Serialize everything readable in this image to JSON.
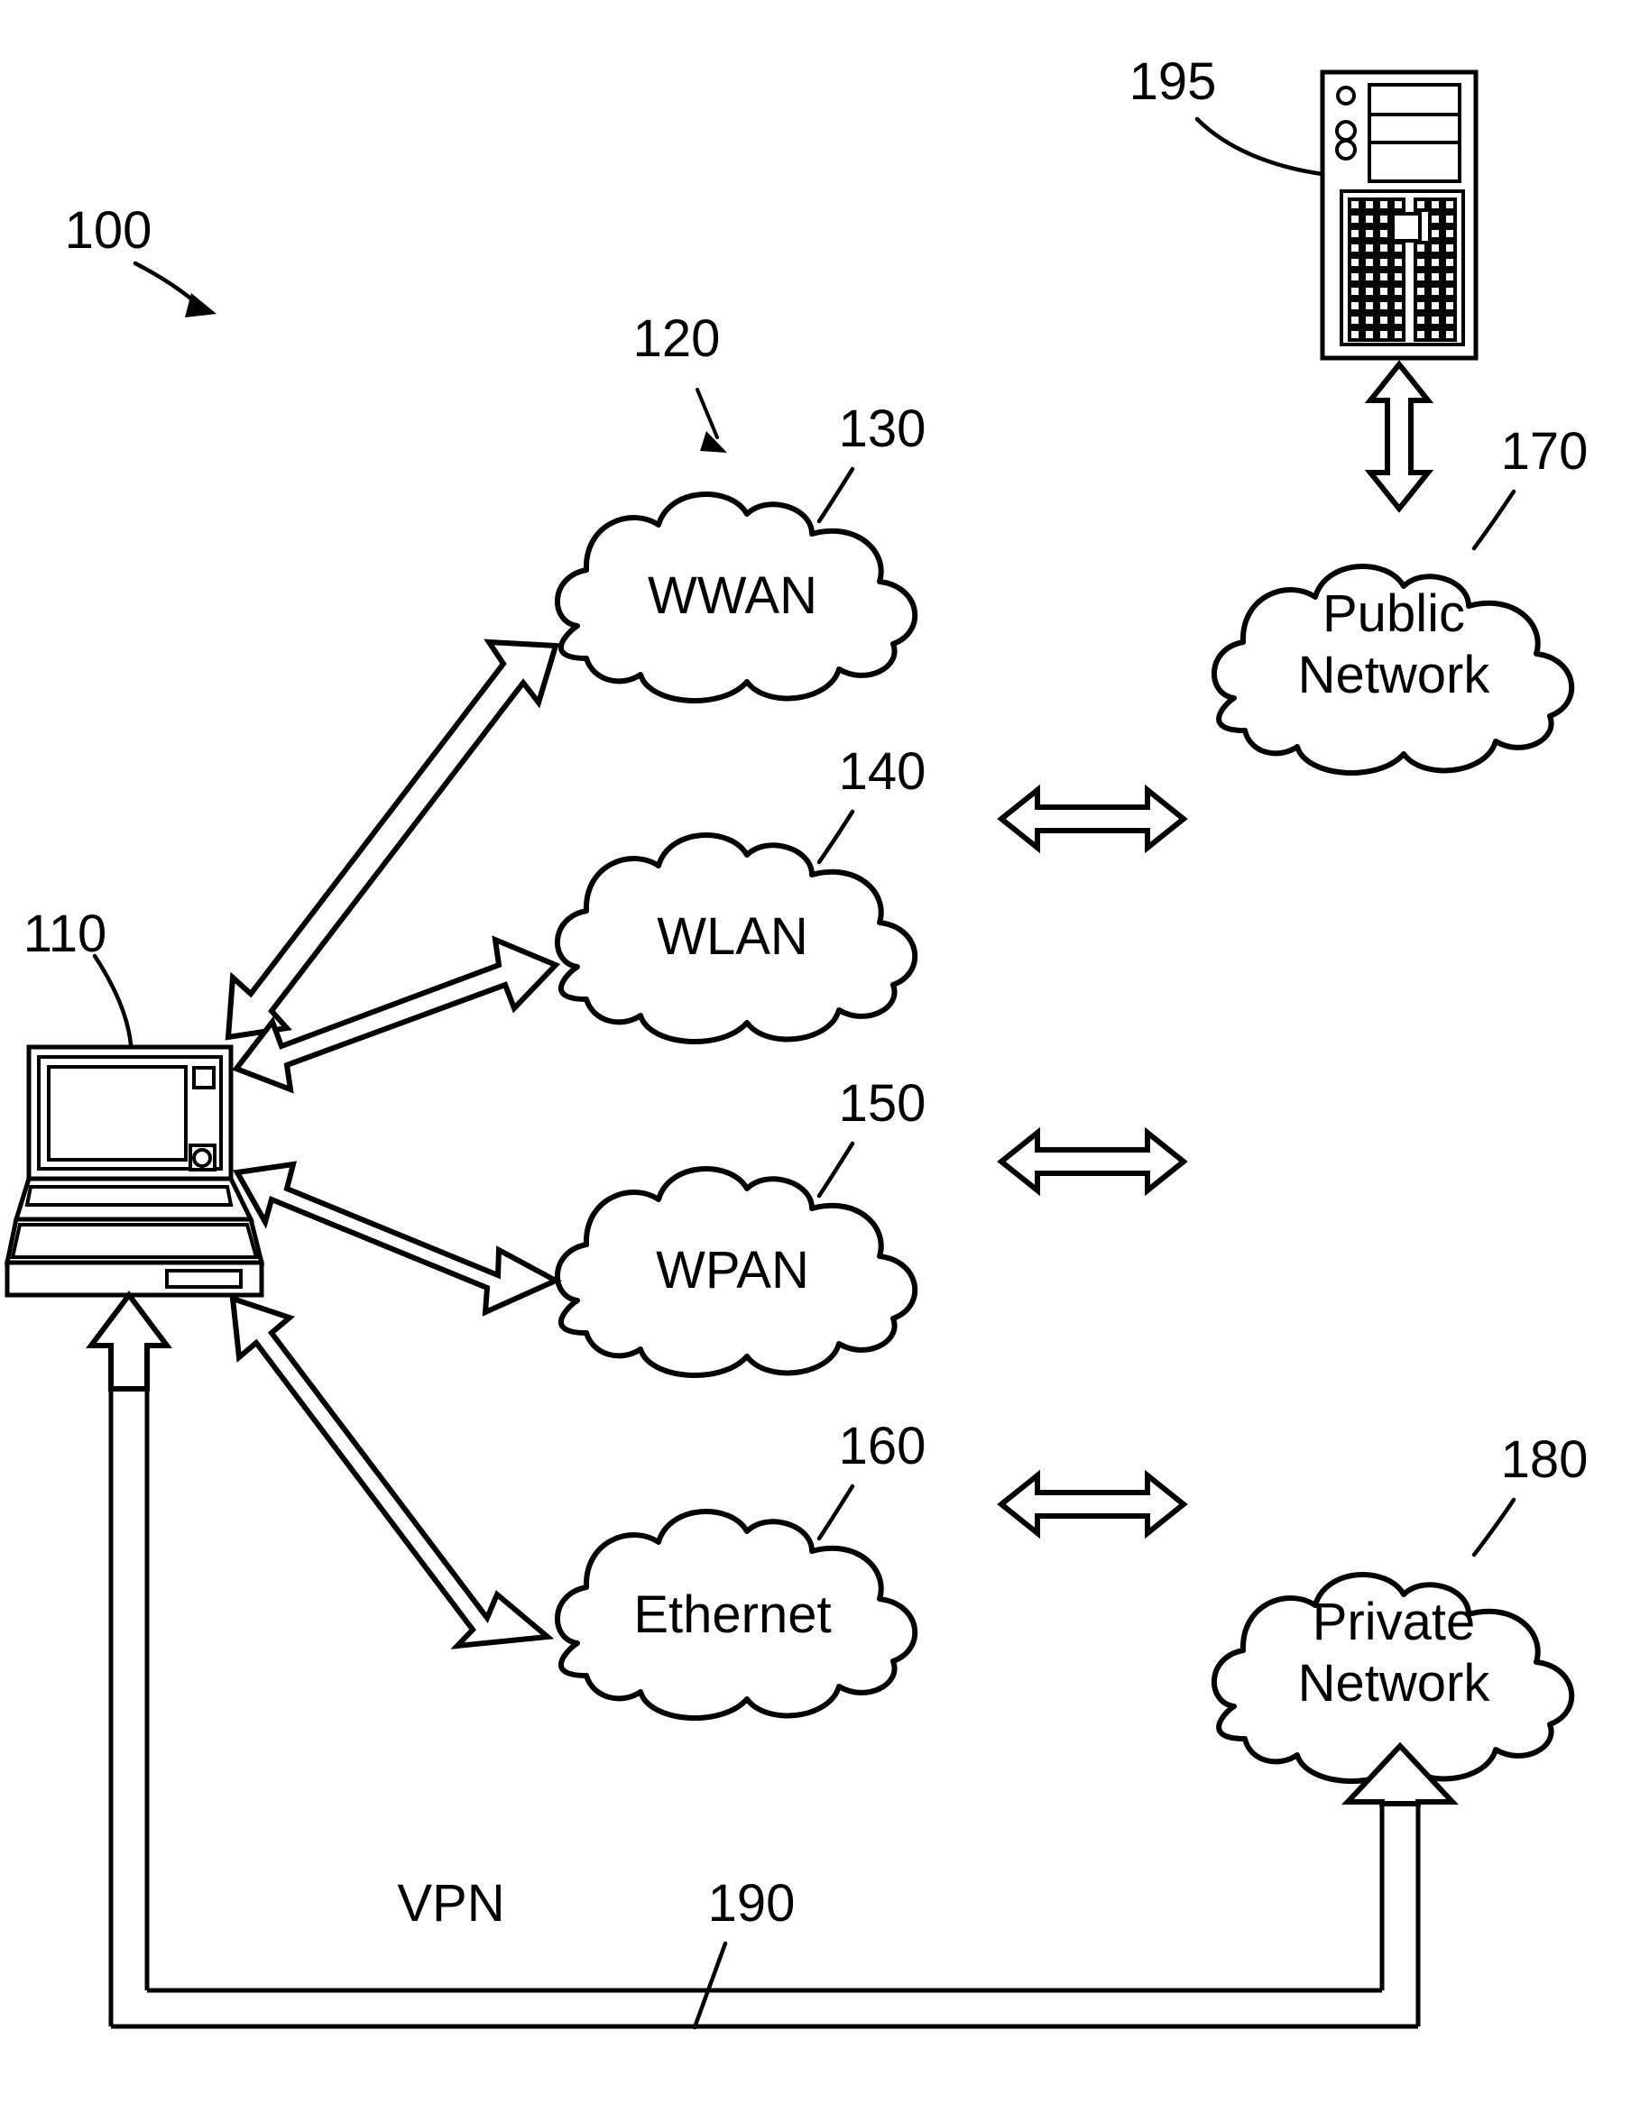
{
  "figure": {
    "title": "Network connectivity block diagram",
    "background_color": "#ffffff",
    "line_color": "#000000"
  },
  "reference_numerals": {
    "system": "100",
    "client_device": "110",
    "access_networks_group": "120",
    "wwan": "130",
    "wlan": "140",
    "wpan": "150",
    "ethernet": "160",
    "public_network": "170",
    "private_network": "180",
    "vpn_tunnel": "190",
    "server": "195"
  },
  "nodes": {
    "laptop": {
      "ref": "110",
      "kind": "laptop-icon",
      "label": ""
    },
    "server": {
      "ref": "195",
      "kind": "server-tower-icon",
      "label": ""
    },
    "clouds": [
      {
        "id": "wwan",
        "ref": "130",
        "label_line1": "WWAN",
        "label_line2": ""
      },
      {
        "id": "wlan",
        "ref": "140",
        "label_line1": "WLAN",
        "label_line2": ""
      },
      {
        "id": "wpan",
        "ref": "150",
        "label_line1": "WPAN",
        "label_line2": ""
      },
      {
        "id": "ethernet",
        "ref": "160",
        "label_line1": "Ethernet",
        "label_line2": ""
      },
      {
        "id": "public",
        "ref": "170",
        "label_line1": "Public",
        "label_line2": "Network"
      },
      {
        "id": "private",
        "ref": "180",
        "label_line1": "Private",
        "label_line2": "Network"
      }
    ]
  },
  "connections": {
    "vpn_label": "VPN",
    "vpn_ref": "190",
    "laptop_to_clouds": [
      "wwan",
      "wlan",
      "wpan",
      "ethernet"
    ],
    "clouds_to_public": [
      "wwan",
      "wlan"
    ],
    "clouds_to_private": [
      "ethernet"
    ],
    "server_to_public": true
  }
}
